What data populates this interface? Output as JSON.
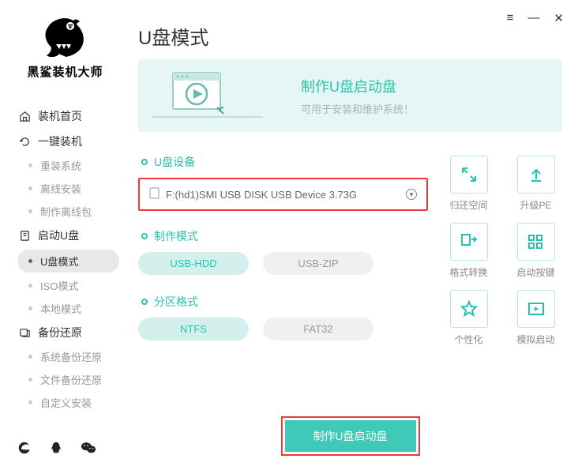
{
  "window": {
    "menu": "≡",
    "min": "—",
    "close": "✕"
  },
  "logo": {
    "text": "黑鲨装机大师"
  },
  "nav": {
    "home": "装机首页",
    "oneclick": "一键装机",
    "oneclick_subs": [
      "重装系统",
      "离线安装",
      "制作离线包"
    ],
    "bootu": "启动U盘",
    "bootu_subs": [
      "U盘模式",
      "ISO模式",
      "本地模式"
    ],
    "backup": "备份还原",
    "backup_subs": [
      "系统备份还原",
      "文件备份还原",
      "自定义安装"
    ]
  },
  "page": {
    "title": "U盘模式",
    "banner_title": "制作U盘启动盘",
    "banner_sub": "可用于安装和维护系统！"
  },
  "sections": {
    "device": "U盘设备",
    "mode": "制作模式",
    "partition": "分区格式"
  },
  "device_value": "F:(hd1)SMI USB DISK USB Device 3.73G",
  "mode_options": [
    "USB-HDD",
    "USB-ZIP"
  ],
  "partition_options": [
    "NTFS",
    "FAT32"
  ],
  "tiles": [
    "归还空间",
    "升级PE",
    "格式转换",
    "启动按键",
    "个性化",
    "模拟启动"
  ],
  "main_button": "制作U盘启动盘"
}
